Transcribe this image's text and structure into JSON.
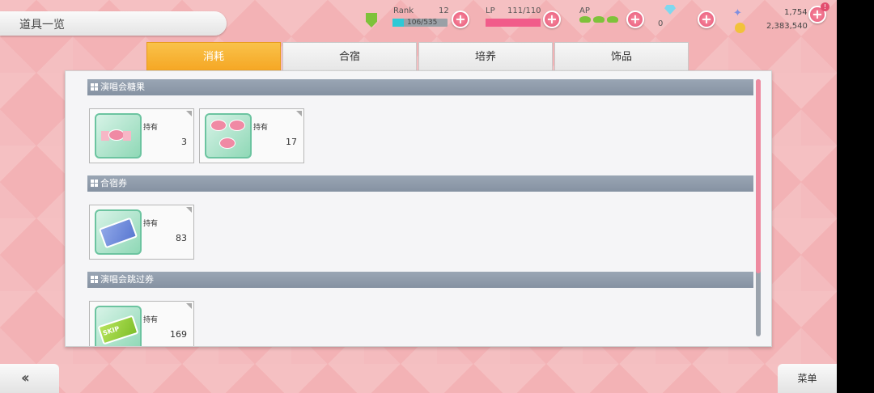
{
  "title": "道具一览",
  "header": {
    "rank_label": "Rank",
    "rank_value": "12",
    "rank_exp": "106/535",
    "rank_progress": 0.2,
    "lp_label": "LP",
    "lp_value": "111/110",
    "lp_progress": 1.0,
    "ap_label": "AP",
    "gem_count": "0",
    "star_count": "1,754",
    "coin_count": "2,383,540",
    "colors": {
      "rank_bar": "#2ec9d6",
      "lp_bar": "#f15c8a",
      "plus_button": "#e8577a"
    }
  },
  "tabs": [
    {
      "label": "消耗",
      "active": true
    },
    {
      "label": "合宿",
      "active": false
    },
    {
      "label": "培养",
      "active": false
    },
    {
      "label": "饰品",
      "active": false
    }
  ],
  "sections": [
    {
      "title": "演唱会糖果",
      "items": [
        {
          "icon": "single-candy-icon",
          "owned_label": "持有",
          "count": "3"
        },
        {
          "icon": "triple-candy-icon",
          "owned_label": "持有",
          "count": "17"
        }
      ]
    },
    {
      "title": "合宿券",
      "items": [
        {
          "icon": "training-ticket-icon",
          "owned_label": "持有",
          "count": "83"
        }
      ]
    },
    {
      "title": "演唱会跳过券",
      "items": [
        {
          "icon": "skip-ticket-icon",
          "owned_label": "持有",
          "count": "169",
          "badge_text": "SKIP"
        }
      ]
    }
  ],
  "footer": {
    "back_label": "‹‹",
    "menu_label": "菜单"
  }
}
